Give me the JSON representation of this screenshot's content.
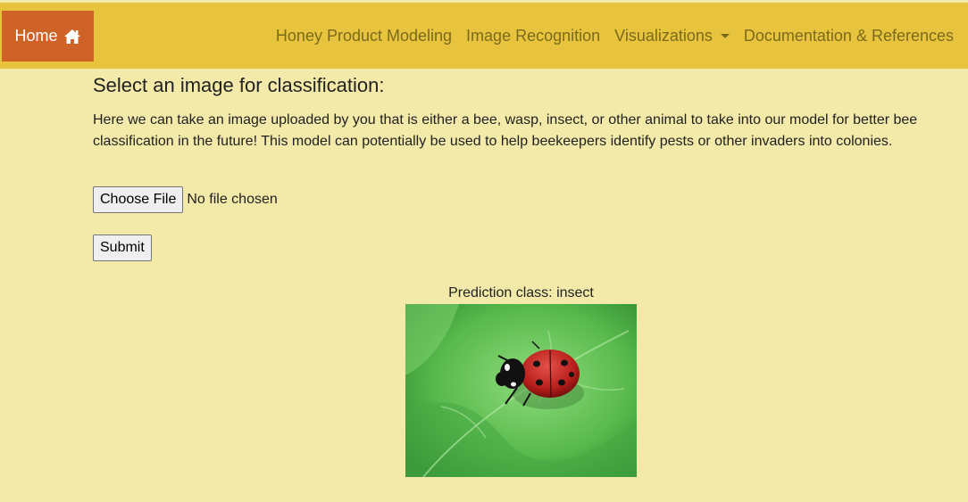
{
  "navbar": {
    "home_label": "Home",
    "home_icon": "home-icon",
    "links": {
      "honey": "Honey Product Modeling",
      "image": "Image Recognition",
      "viz": "Visualizations",
      "docs": "Documentation & References"
    }
  },
  "colors": {
    "page_bg": "#f3e9a9",
    "navbar_bg": "#e8c33d",
    "home_bg": "#cf6227",
    "nav_text": "#7a6a1c"
  },
  "main": {
    "title": "Select an image for classification:",
    "description": "Here we can take an image uploaded by you that is either a bee, wasp, insect, or other animal to take into our model for better bee classification in the future! This model can potentially be used to help beekeepers identify pests or other invaders into colonies.",
    "choose_file_label": "Choose File",
    "file_status": "No file chosen",
    "submit_label": "Submit",
    "prediction_label": "Prediction class: insect"
  }
}
